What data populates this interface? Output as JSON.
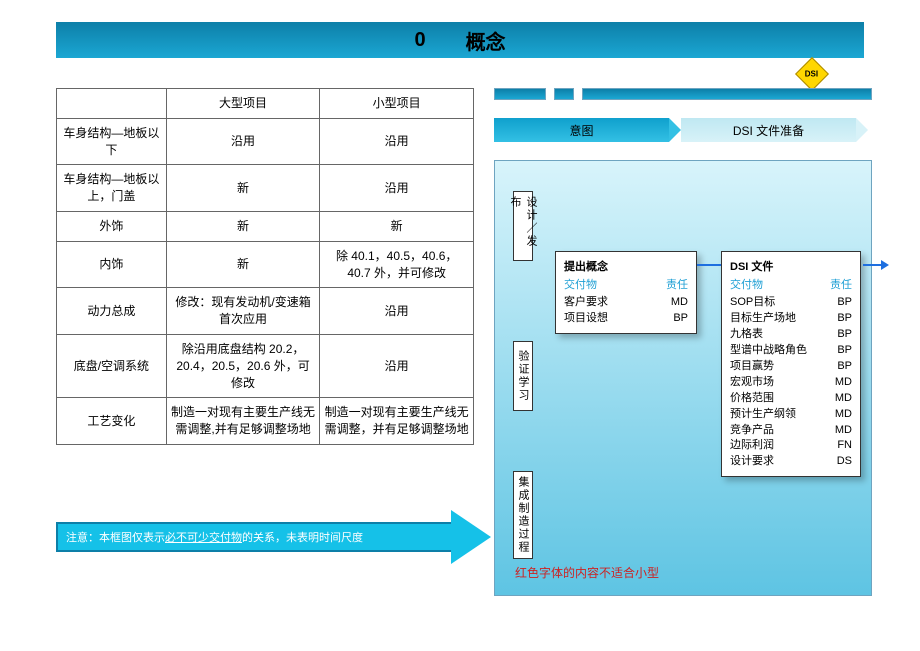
{
  "title": {
    "num": "0",
    "text": "概念"
  },
  "dsi_label": "DSI",
  "arrow_band": {
    "seg1": "意图",
    "seg2": "DSI 文件准备"
  },
  "table": {
    "headers": [
      "",
      "大型项目",
      "小型项目"
    ],
    "rows": [
      [
        "车身结构—地板以下",
        "沿用",
        "沿用"
      ],
      [
        "车身结构—地板以上，门盖",
        "新",
        "沿用"
      ],
      [
        "外饰",
        "新",
        "新"
      ],
      [
        "内饰",
        "新",
        "除 40.1，40.5，40.6，40.7 外，并可修改"
      ],
      [
        "动力总成",
        "修改：现有发动机/变速箱首次应用",
        "沿用"
      ],
      [
        "底盘/空调系统",
        "除沿用底盘结构 20.2，20.4，20.5，20.6 外，可修改",
        "沿用"
      ],
      [
        "工艺变化",
        "制造一对现有主要生产线无需调整,并有足够调整场地",
        "制造一对现有主要生产线无需调整，并有足够调整场地"
      ]
    ]
  },
  "swimlanes": [
    "设计／发布",
    "验证学习",
    "集成制造过程"
  ],
  "card1": {
    "title": "提出概念",
    "hdr": [
      "交付物",
      "责任"
    ],
    "rows": [
      [
        "客户要求",
        "MD"
      ],
      [
        "项目设想",
        "BP"
      ]
    ]
  },
  "card2": {
    "title": "DSI 文件",
    "hdr": [
      "交付物",
      "责任"
    ],
    "rows": [
      [
        "SOP目标",
        "BP"
      ],
      [
        "目标生产场地",
        "BP"
      ],
      [
        "九格表",
        "BP"
      ],
      [
        "型谱中战略角色",
        "BP"
      ],
      [
        "项目赢势",
        "BP"
      ],
      [
        "宏观市场",
        "MD"
      ],
      [
        "价格范围",
        "MD"
      ],
      [
        "预计生产纲领",
        "MD"
      ],
      [
        "竞争产品",
        "MD"
      ],
      [
        "边际利润",
        "FN"
      ],
      [
        "设计要求",
        "DS"
      ]
    ]
  },
  "red_note": "红色字体的内容不适合小型",
  "note_arrow": {
    "prefix": "注意：本框图仅表示",
    "underline": "必不可少交付物",
    "suffix": "的关系，未表明时间尺度"
  }
}
